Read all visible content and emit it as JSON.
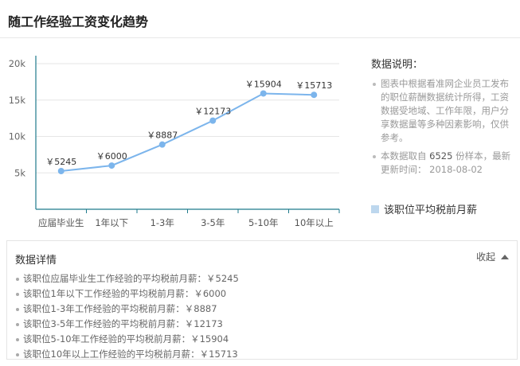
{
  "page": {
    "title": "随工作经验工资变化趋势"
  },
  "chart_data": {
    "type": "line",
    "categories": [
      "应届毕业生",
      "1年以下",
      "1-3年",
      "3-5年",
      "5-10年",
      "10年以上"
    ],
    "values": [
      5245,
      6000,
      8887,
      12173,
      15904,
      15713
    ],
    "value_labels": [
      "￥5245",
      "￥6000",
      "￥8887",
      "￥12173",
      "￥15904",
      "￥15713"
    ],
    "ylim": [
      0,
      20000
    ],
    "yticks": [
      5000,
      10000,
      15000,
      20000
    ],
    "ytick_labels": [
      "5k",
      "10k",
      "15k",
      "20k"
    ],
    "grid": true,
    "line_color": "#7cb5ec",
    "legend": {
      "label": "该职位平均税前月薪",
      "color": "#bdd7ee",
      "position": "right"
    }
  },
  "side": {
    "title": "数据说明：",
    "items": [
      {
        "text": "图表中根据看准网企业员工发布的职位薪酬数据统计所得，工资数据受地域、工作年限，用户分享数据量等多种因素影响，仅供参考。"
      },
      {
        "pre": "本数据取自 ",
        "num": "6525",
        "post": " 份样本，最新更新时间： 2018-08-02"
      }
    ]
  },
  "details": {
    "title": "数据详情",
    "collapse_label": "收起",
    "items": [
      "该职位应届毕业生工作经验的平均税前月薪：￥5245",
      "该职位1年以下工作经验的平均税前月薪：￥6000",
      "该职位1-3年工作经验的平均税前月薪：￥8887",
      "该职位3-5年工作经验的平均税前月薪：￥12173",
      "该职位5-10年工作经验的平均税前月薪：￥15904",
      "该职位10年以上工作经验的平均税前月薪：￥15713"
    ]
  }
}
